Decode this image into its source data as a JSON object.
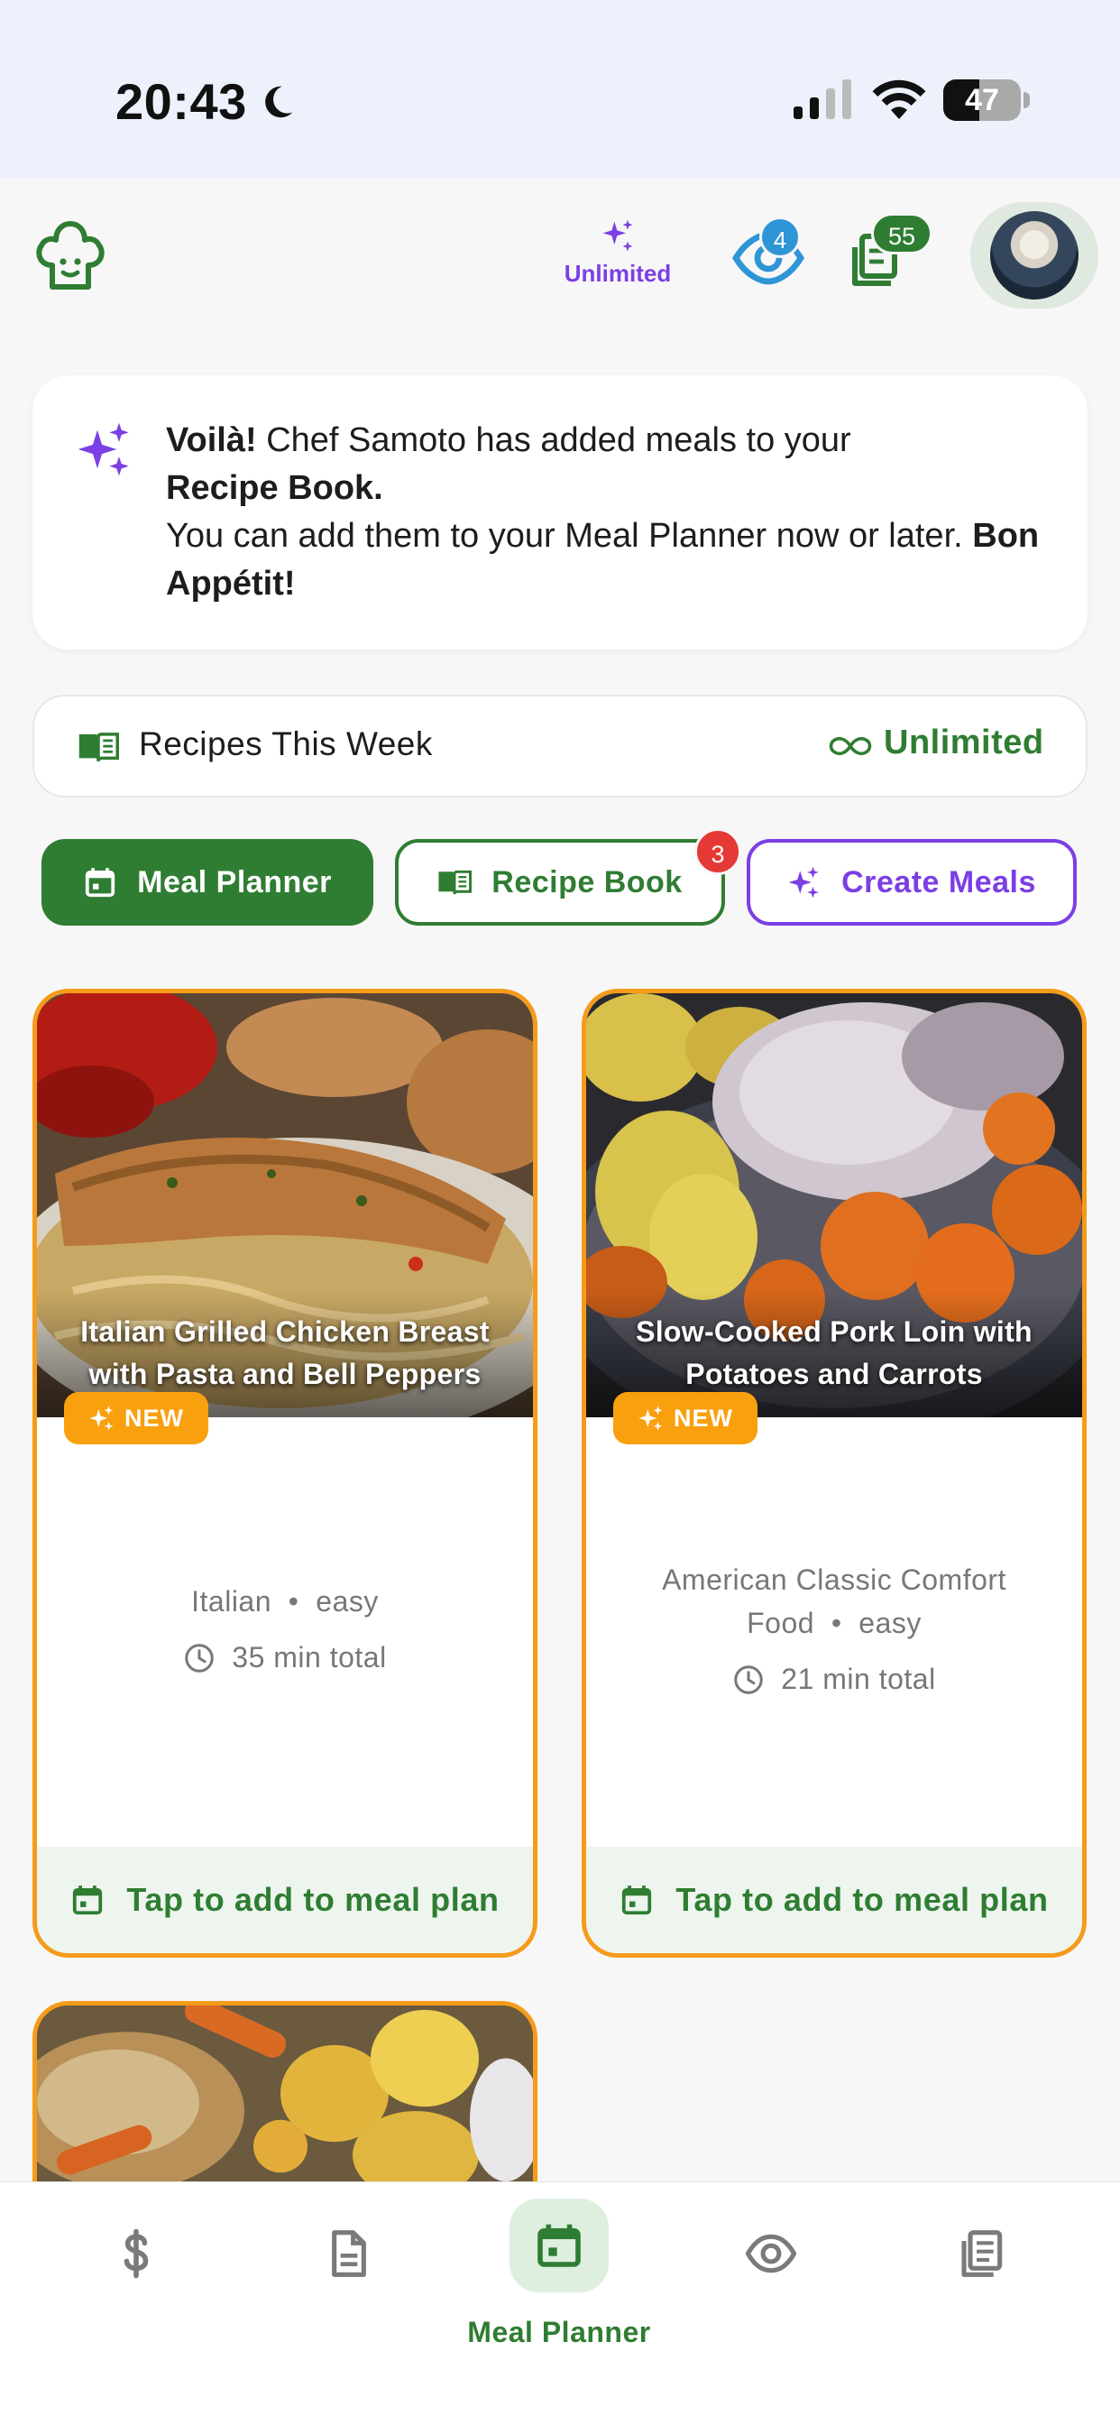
{
  "status_bar": {
    "time": "20:43",
    "battery": "47",
    "battery_level": 0.47
  },
  "top_bar": {
    "unlimited_label": "Unlimited",
    "eye_badge": "4",
    "recipes_badge": "55",
    "icons": [
      "chef-hat-icon",
      "sparkles-icon",
      "eye-icon",
      "recipe-stack-icon",
      "avatar"
    ]
  },
  "notice": {
    "bold_1": "Voilà!",
    "text_1": " Chef Samoto has added meals to your ",
    "bold_2": "Recipe Book.",
    "text_2": "You can add them to your Meal Planner now or later. ",
    "bold_3": "Bon Appétit!"
  },
  "week": {
    "label": "Recipes This Week",
    "value": "Unlimited"
  },
  "chips": {
    "meal_planner": "Meal Planner",
    "recipe_book": "Recipe Book",
    "recipe_book_badge": "3",
    "create_meals": "Create Meals"
  },
  "cards": [
    {
      "title": "Italian Grilled Chicken Breast with Pasta and Bell Peppers",
      "badge": "NEW",
      "cuisine": "Italian",
      "separator": "•",
      "difficulty": "easy",
      "time": "35 min total",
      "cta": "Tap to add to meal plan"
    },
    {
      "title": "Slow-Cooked Pork Loin with Potatoes and Carrots",
      "badge": "NEW",
      "cuisine": "American Classic Comfort Food",
      "separator": "•",
      "difficulty": "easy",
      "time": "21 min total",
      "cta": "Tap to add to meal plan"
    }
  ],
  "bottom_nav": {
    "active_label": "Meal Planner",
    "items": [
      "dollar-icon",
      "document-icon",
      "calendar-icon",
      "eye-icon",
      "recipes-icon"
    ]
  },
  "colors": {
    "primary": "#2f7d32",
    "accent": "#7b3fe4",
    "card_border": "#f59b1a",
    "badge_red": "#e53935",
    "eye_badge": "#2e95d6"
  }
}
